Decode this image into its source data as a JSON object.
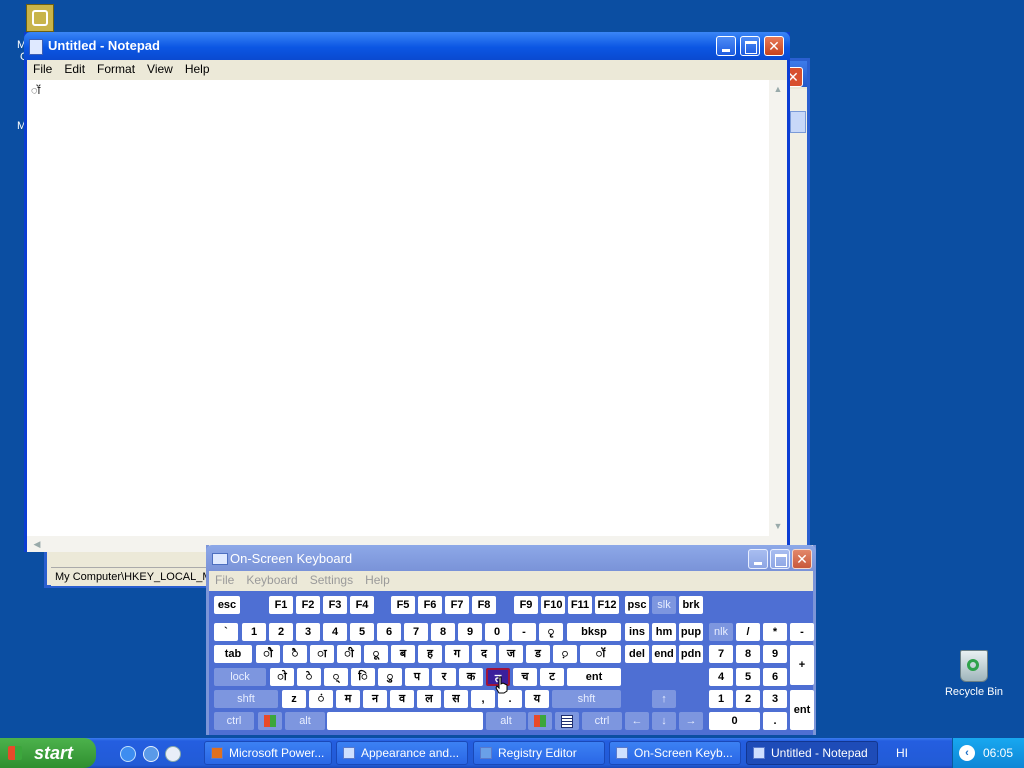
{
  "desktop": {
    "recycle_bin_label": "Recycle Bin",
    "frag_m1": "M",
    "frag_c": "C",
    "frag_m2": "M"
  },
  "registry_editor": {
    "status_path": "My Computer\\HKEY_LOCAL_MAC"
  },
  "notepad": {
    "title": "Untitled - Notepad",
    "menu": [
      "File",
      "Edit",
      "Format",
      "View",
      "Help"
    ],
    "content": "ॉ"
  },
  "osk": {
    "title": "On-Screen Keyboard",
    "menu": [
      "File",
      "Keyboard",
      "Settings",
      "Help"
    ],
    "keys": {
      "row1": [
        "esc",
        "F1",
        "F2",
        "F3",
        "F4",
        "F5",
        "F6",
        "F7",
        "F8",
        "F9",
        "F10",
        "F11",
        "F12",
        "psc",
        "slk",
        "brk"
      ],
      "row2": [
        "`",
        "1",
        "2",
        "3",
        "4",
        "5",
        "6",
        "7",
        "8",
        "9",
        "0",
        "-",
        "ृ",
        "bksp",
        "ins",
        "hm",
        "pup",
        "nlk",
        "/",
        "*",
        "-"
      ],
      "row3": [
        "tab",
        "ौ",
        "ै",
        "ा",
        "ी",
        "ू",
        "ब",
        "ह",
        "ग",
        "द",
        "ज",
        "ड",
        "़",
        "ॉ",
        "del",
        "end",
        "pdn",
        "7",
        "8",
        "9",
        "+"
      ],
      "row4": [
        "lock",
        "ो",
        "े",
        "्",
        "ि",
        "ु",
        "प",
        "र",
        "क",
        "त",
        "च",
        "ट",
        "ent",
        "4",
        "5",
        "6"
      ],
      "row5": [
        "shft",
        "z",
        "ं",
        "म",
        "न",
        "व",
        "ल",
        "स",
        ",",
        ".",
        "य",
        "shft",
        "↑",
        "1",
        "2",
        "3",
        "ent"
      ],
      "row6": [
        "ctrl",
        "alt",
        "alt",
        "ctrl",
        "←",
        "↓",
        "→",
        "0",
        "."
      ]
    }
  },
  "taskbar": {
    "start_label": "start",
    "tasks": [
      "Microsoft Power...",
      "Appearance and...",
      "Registry Editor",
      "On-Screen Keyb...",
      "Untitled - Notepad"
    ],
    "language": "HI",
    "clock": "06:05"
  }
}
